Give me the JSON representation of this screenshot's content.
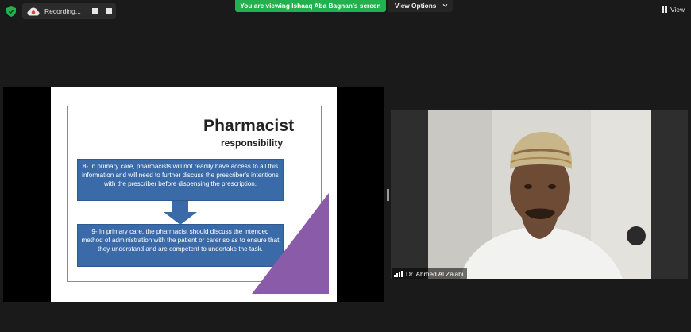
{
  "toolbar": {
    "recording_label": "Recording...",
    "viewing_banner": "You are viewing Ishaaq Aba Bagnan's screen",
    "view_options_label": "View Options",
    "view_label": "View"
  },
  "slide": {
    "title": "Pharmacist",
    "subtitle": "responsibility",
    "box1_text": "8- In primary care, pharmacists will not readily have access to all this information and will need to further discuss the prescriber's intentions with the prescriber before dispensing the prescription.",
    "box2_text": "9- In primary care, the pharmacist should discuss the intended method of administration with the patient or carer so as to ensure that they understand and are competent to undertake the task.",
    "box_color": "#3a6ba8",
    "triangle_color": "#8a5ba8"
  },
  "participant": {
    "name": "Dr. Ahmed Al Za'abi"
  },
  "colors": {
    "banner": "#23b14d",
    "shield": "#23b14d",
    "background": "#1a1a1a"
  }
}
